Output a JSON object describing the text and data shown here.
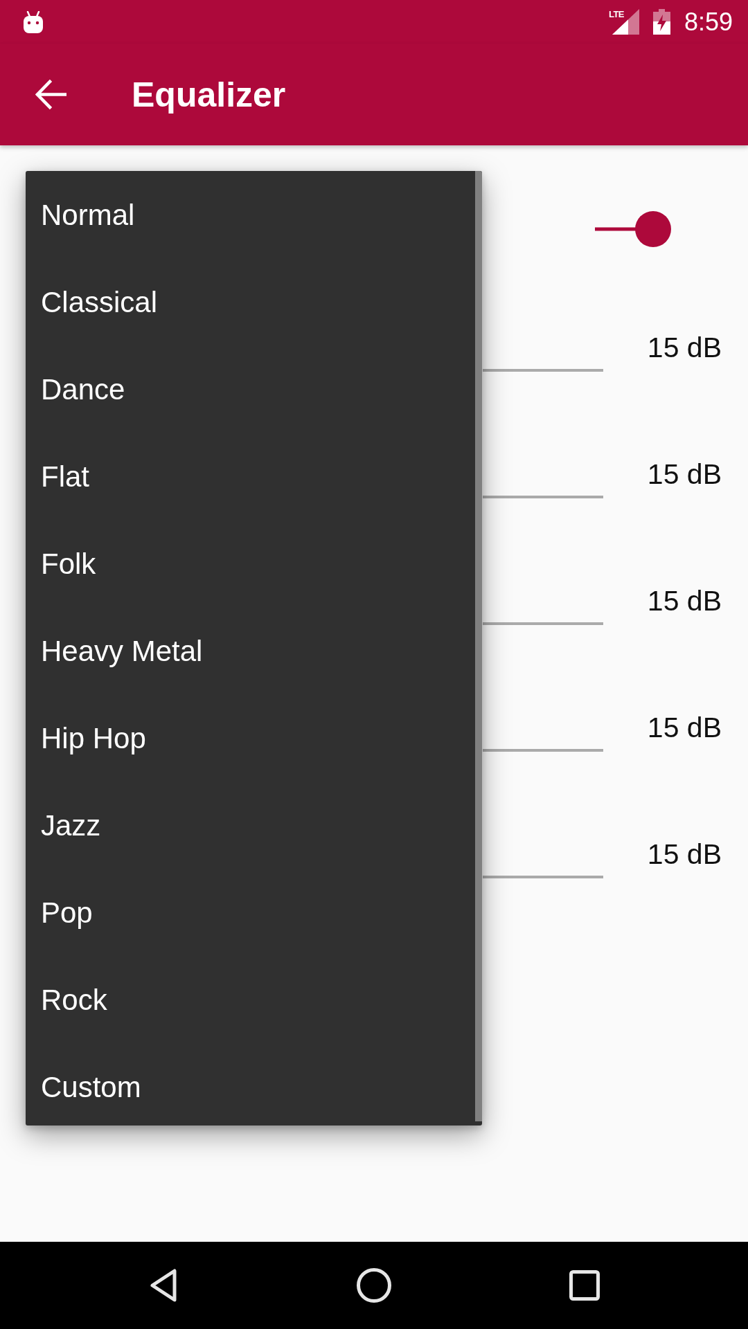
{
  "status_bar": {
    "network_type": "LTE",
    "time": "8:59"
  },
  "app_bar": {
    "title": "Equalizer"
  },
  "enable_switch": {
    "on": true
  },
  "bands": [
    {
      "reading": "15 dB"
    },
    {
      "reading": "15 dB"
    },
    {
      "reading": "15 dB"
    },
    {
      "reading": "15 dB"
    },
    {
      "reading": "15 dB"
    }
  ],
  "preset_menu": {
    "items": [
      "Normal",
      "Classical",
      "Dance",
      "Flat",
      "Folk",
      "Heavy Metal",
      "Hip Hop",
      "Jazz",
      "Pop",
      "Rock",
      "Custom"
    ]
  }
}
